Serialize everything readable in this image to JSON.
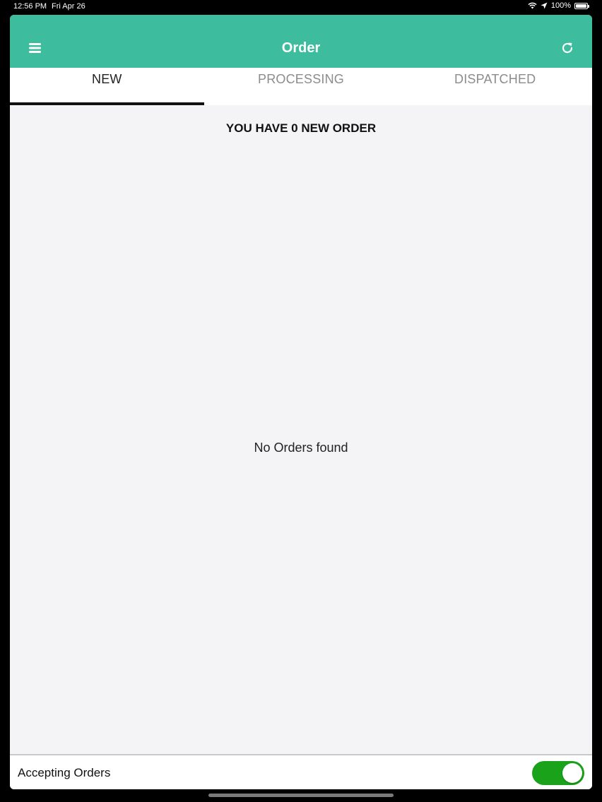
{
  "status_bar": {
    "time": "12:56 PM",
    "date": "Fri Apr 26",
    "battery": "100%",
    "icons": [
      "wifi-icon",
      "location-arrow-icon",
      "battery-icon"
    ]
  },
  "header": {
    "title": "Order",
    "menu_icon": "hamburger-menu-icon",
    "refresh_icon": "refresh-icon",
    "background_color": "#3dbd9e"
  },
  "tabs": [
    {
      "label": "NEW",
      "active": true
    },
    {
      "label": "PROCESSING",
      "active": false
    },
    {
      "label": "DISPATCHED",
      "active": false
    }
  ],
  "main": {
    "count_heading": "YOU HAVE 0 NEW ORDER",
    "empty_message": "No Orders found"
  },
  "footer": {
    "accepting_label": "Accepting Orders",
    "accepting_enabled": true,
    "toggle_color": "#1aa31a"
  }
}
